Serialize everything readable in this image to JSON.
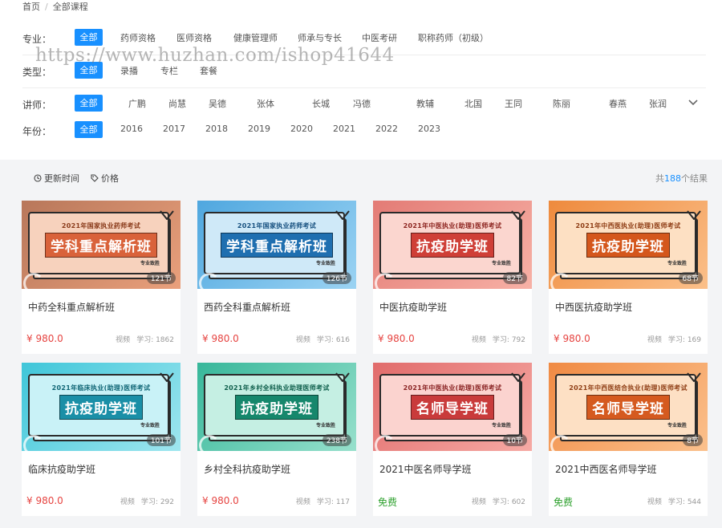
{
  "breadcrumb": {
    "home": "首页",
    "separator": "/",
    "current": "全部课程"
  },
  "watermark": "https://www.huzhan.com/ishop41644",
  "filters": {
    "specialty": {
      "label": "专业：",
      "options": [
        "全部",
        "药师资格",
        "医师资格",
        "健康管理师",
        "师承与专长",
        "中医考研",
        "职称药师（初级）"
      ]
    },
    "type": {
      "label": "类型：",
      "options": [
        "全部",
        "录播",
        "专栏",
        "套餐"
      ]
    },
    "teacher": {
      "label": "讲师：",
      "options": [
        "全部",
        "广鹏",
        "尚慧",
        "吴德",
        "张体",
        "长城",
        "冯德",
        "教辅",
        "北国",
        "王同",
        "陈丽",
        "春燕",
        "张润"
      ]
    },
    "year": {
      "label": "年份：",
      "options": [
        "全部",
        "2016",
        "2017",
        "2018",
        "2019",
        "2020",
        "2021",
        "2022",
        "2023"
      ]
    }
  },
  "sort": {
    "time_label": "更新时间",
    "price_label": "价格"
  },
  "results": {
    "prefix": "共",
    "count": "188",
    "suffix": "个结果"
  },
  "colors": {
    "accent": "#1890ff",
    "price": "#e64340",
    "free": "#2ca02c"
  },
  "courses": [
    {
      "subtitle": "2021年国家执业药师考试",
      "banner": "学科重点解析班",
      "brand": "专业致胜",
      "lessons": "121节",
      "title": "中药全科重点解析班",
      "price": "¥ 980.0",
      "type": "视频",
      "learn": "学习: 1862"
    },
    {
      "subtitle": "2021年国家执业药师考试",
      "banner": "学科重点解析班",
      "brand": "专业致胜",
      "lessons": "126节",
      "title": "西药全科重点解析班",
      "price": "¥ 980.0",
      "type": "视频",
      "learn": "学习: 616"
    },
    {
      "subtitle": "2021年中医执业(助理)医师考试",
      "banner": "抗疫助学班",
      "brand": "专业致胜",
      "lessons": "82节",
      "title": "中医抗疫助学班",
      "price": "¥ 980.0",
      "type": "视频",
      "learn": "学习: 792"
    },
    {
      "subtitle": "2021年中西医执业(助理)医师考试",
      "banner": "抗疫助学班",
      "brand": "专业致胜",
      "lessons": "68节",
      "title": "中西医抗疫助学班",
      "price": "¥ 980.0",
      "type": "视频",
      "learn": "学习: 169"
    },
    {
      "subtitle": "2021年临床执业(助理)医师考试",
      "banner": "抗疫助学班",
      "brand": "专业致胜",
      "lessons": "101节",
      "title": "临床抗疫助学班",
      "price": "¥ 980.0",
      "type": "视频",
      "learn": "学习: 292"
    },
    {
      "subtitle": "2021年乡村全科执业助理医师考试",
      "banner": "抗疫助学班",
      "brand": "专业致胜",
      "lessons": "238节",
      "title": "乡村全科抗疫助学班",
      "price": "¥ 980.0",
      "type": "视频",
      "learn": "学习: 117"
    },
    {
      "subtitle": "2021年中医执业(助理)医师考试",
      "banner": "名师导学班",
      "brand": "专业致胜",
      "lessons": "10节",
      "title": "2021中医名师导学班",
      "price": "免费",
      "type": "视频",
      "learn": "学习: 602"
    },
    {
      "subtitle": "2021年中西医结合执业(助理)医师考试",
      "banner": "名师导学班",
      "brand": "专业致胜",
      "lessons": "8节",
      "title": "2021中西医名师导学班",
      "price": "免费",
      "type": "视频",
      "learn": "学习: 544"
    }
  ]
}
